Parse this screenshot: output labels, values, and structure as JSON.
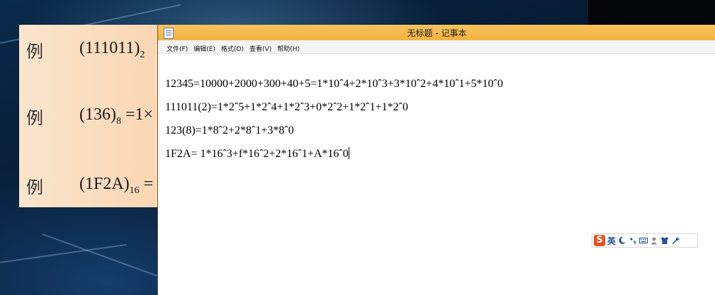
{
  "slide": {
    "rows": [
      {
        "char": "例",
        "math_pre": "(111011)",
        "math_sub": "2",
        "math_post": ""
      },
      {
        "char": "例",
        "math_pre": "(136)",
        "math_sub": "8",
        "math_post": " =1×"
      },
      {
        "char": "例",
        "math_pre": "(1F2A)",
        "math_sub": "16",
        "math_post": " ="
      }
    ]
  },
  "notepad": {
    "title": "无标题 - 记事本",
    "menu": [
      {
        "label": "文件(F)"
      },
      {
        "label": "编辑(E)"
      },
      {
        "label": "格式(O)"
      },
      {
        "label": "查看(V)"
      },
      {
        "label": "帮助(H)"
      }
    ],
    "lines": [
      "12345=10000+2000+300+40+5=1*10ˆ4+2*10ˆ3+3*10ˆ2+4*10ˆ1+5*10ˆ0",
      "111011(2)=1*2ˆ5+1*2ˆ4+1*2ˆ3+0*2ˆ2+1*2ˆ1+1*2ˆ0",
      "123(8)=1*8ˆ2+2*8ˆ1+3*8ˆ0",
      "1F2A= 1*16ˆ3+f*16ˆ2+2*16ˆ1+A*16ˆ0"
    ]
  },
  "ime_toolbar": {
    "logo": "S",
    "mode": "英",
    "icons": [
      "moon-icon",
      "punctuation-icon",
      "keyboard-icon",
      "user-icon",
      "skin-icon",
      "tools-icon"
    ]
  },
  "colors": {
    "titlebar": "#f3b23f",
    "slide_bg": "#f9d6b3",
    "ime_logo": "#e8501a"
  }
}
